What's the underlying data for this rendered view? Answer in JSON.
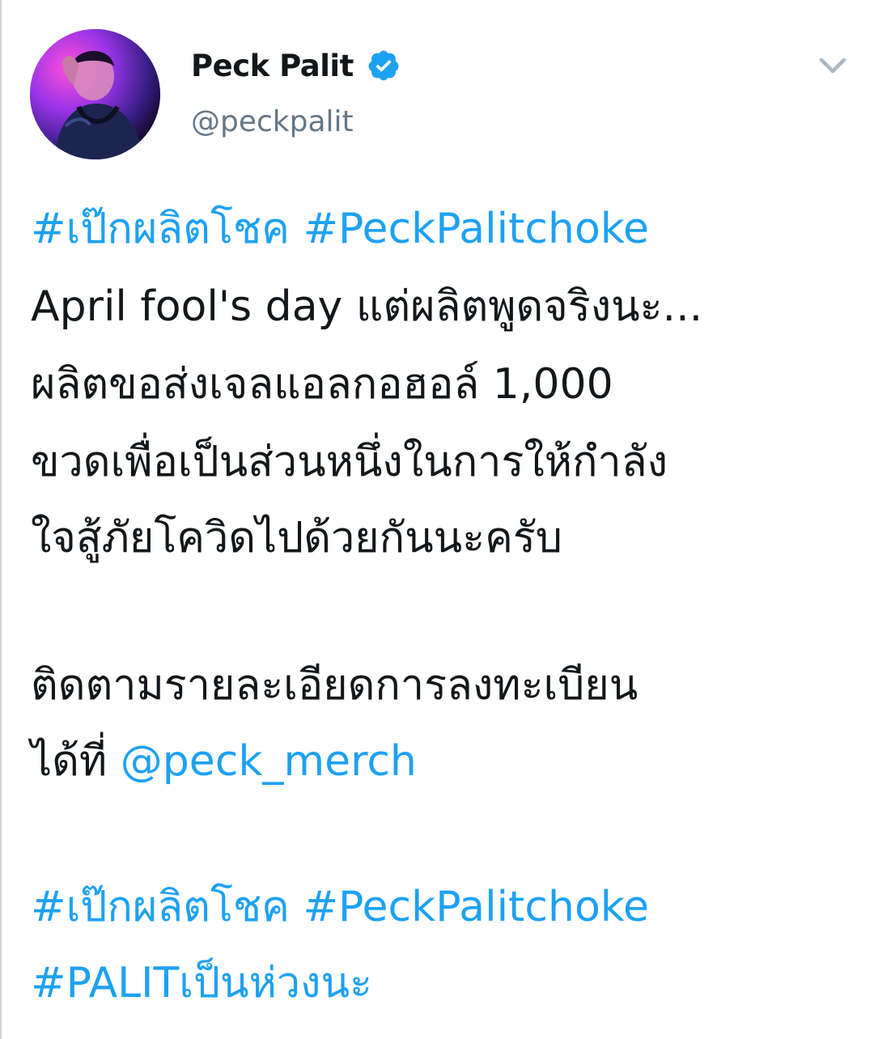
{
  "user": {
    "display_name": "Peck Palit",
    "handle": "@peckpalit",
    "verified": true,
    "avatar_icon": "profile-photo-icon"
  },
  "tweet": {
    "line1": {
      "hashtag1": "#เป๊กผลิตโชค",
      "hashtag2": "#PeckPalitchoke"
    },
    "line2": "April fool's day แต่ผลิตพูดจริงนะ...",
    "line3": "ผลิตขอส่งเจลแอลกอฮอล์ 1,000",
    "line4": "ขวดเพื่อเป็นส่วนหนึ่งในการให้กำลัง",
    "line5": "ใจสู้ภัยโควิดไปด้วยกันนะครับ",
    "line6": "ติดตามรายละเอียดการลงทะเบียน",
    "line7": {
      "prefix": "ได้ที่",
      "mention": "@peck_merch"
    },
    "line8": {
      "hashtag1": "#เป๊กผลิตโชค",
      "hashtag2": "#PeckPalitchoke"
    },
    "line9": "#PALITเป็นห่วงนะ"
  },
  "colors": {
    "link": "#1da1f2",
    "text": "#14171a",
    "secondary": "#657786",
    "caret": "#aab8c2"
  }
}
